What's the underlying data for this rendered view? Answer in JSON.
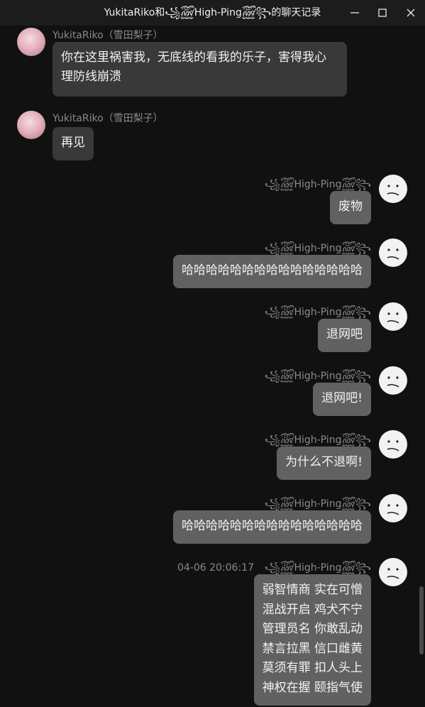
{
  "window": {
    "title": "YukitaRiko和꧁꫞High-Ping꫞꧂的聊天记录",
    "controls": {
      "minimize": "minimize-icon",
      "maximize": "maximize-icon",
      "close": "close-icon"
    }
  },
  "colors": {
    "background": "#111111",
    "bubble_left": "#393939",
    "bubble_right": "#616161",
    "name_text": "#8a8a8a"
  },
  "messages": [
    {
      "sender": "YukitaRiko（雪田梨子）",
      "side": "left",
      "text_lines": [
        "你在这里祸害我，无底线的看我的乐子，害得我心",
        "理防线崩溃"
      ]
    },
    {
      "sender": "YukitaRiko（雪田梨子）",
      "side": "left",
      "text_lines": [
        "再见"
      ]
    },
    {
      "sender": "꧁꫞High-Ping꫞꧂",
      "side": "right",
      "text_lines": [
        "废物"
      ]
    },
    {
      "sender": "꧁꫞High-Ping꫞꧂",
      "side": "right",
      "text_lines": [
        "哈哈哈哈哈哈哈哈哈哈哈哈哈哈哈"
      ]
    },
    {
      "sender": "꧁꫞High-Ping꫞꧂",
      "side": "right",
      "text_lines": [
        "退网吧"
      ]
    },
    {
      "sender": "꧁꫞High-Ping꫞꧂",
      "side": "right",
      "text_lines": [
        "退网吧!"
      ]
    },
    {
      "sender": "꧁꫞High-Ping꫞꧂",
      "side": "right",
      "text_lines": [
        "为什么不退啊!"
      ]
    },
    {
      "sender": "꧁꫞High-Ping꫞꧂",
      "side": "right",
      "text_lines": [
        "哈哈哈哈哈哈哈哈哈哈哈哈哈哈哈"
      ]
    },
    {
      "sender": "꧁꫞High-Ping꫞꧂",
      "side": "right",
      "timestamp": "04-06 20:06:17",
      "text_lines": [
        "弱智情商 实在可憎",
        "混战开启 鸡犬不宁",
        "管理员名 你敢乱动",
        "禁言拉黑 信口雌黄",
        "莫须有罪 扣人头上",
        "神权在握 颐指气使"
      ]
    }
  ]
}
